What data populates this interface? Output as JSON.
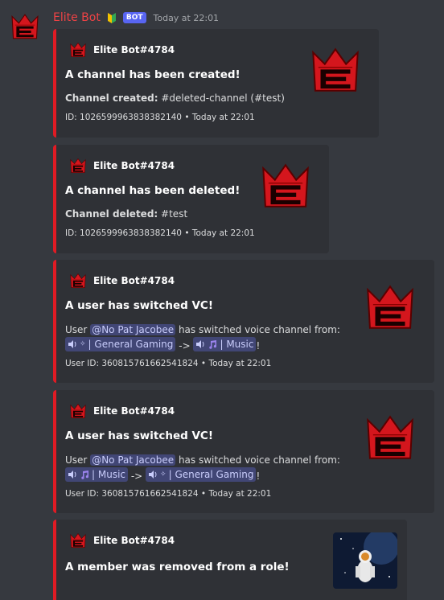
{
  "message": {
    "username": "Elite Bot",
    "bot_tag": "BOT",
    "timestamp": "Today at 22:01"
  },
  "embeds": [
    {
      "author": "Elite Bot#4784",
      "title": "A channel has been created!",
      "field_label": "Channel created:",
      "field_value": "#deleted-channel (#test)",
      "footer": "ID: 1026599963838382140 • Today at 22:01"
    },
    {
      "author": "Elite Bot#4784",
      "title": "A channel has been deleted!",
      "field_label": "Channel deleted:",
      "field_value": "#test",
      "footer": "ID: 1026599963838382140 • Today at 22:01"
    },
    {
      "author": "Elite Bot#4784",
      "title": "A user has switched VC!",
      "desc_prefix": "User",
      "user_mention": "@No Pat Jacobee",
      "desc_suffix": "has switched voice channel from:",
      "from_channel": "| General Gaming",
      "arrow": "->",
      "to_channel": "| Music",
      "end": "!",
      "footer": "User ID: 360815761662541824 • Today at 22:01"
    },
    {
      "author": "Elite Bot#4784",
      "title": "A user has switched VC!",
      "desc_prefix": "User",
      "user_mention": "@No Pat Jacobee",
      "desc_suffix": "has switched voice channel from:",
      "from_channel": "| Music",
      "arrow": "->",
      "to_channel": "| General Gaming",
      "end": "!",
      "footer": "User ID: 360815761662541824 • Today at 22:01"
    },
    {
      "author": "Elite Bot#4784",
      "title": "A member was removed from a role!"
    }
  ],
  "colors": {
    "accent": "#e01b24",
    "username": "#ed4245",
    "bot_tag": "#5865f2"
  },
  "icons": [
    "crown-logo-icon",
    "beginner-badge-icon",
    "speaker-icon",
    "sparkles-icon",
    "music-note-icon",
    "astronaut-thumbnail"
  ]
}
